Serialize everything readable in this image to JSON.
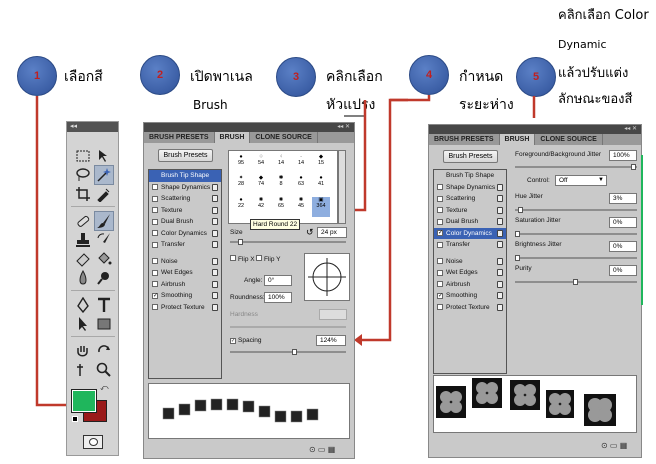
{
  "steps": [
    {
      "num": "1",
      "text": "เลือกสี"
    },
    {
      "num": "2",
      "text": "เปิดพาเนล",
      "text2": "Brush"
    },
    {
      "num": "3",
      "text": "คลิกเลือก",
      "text2": "หัวแปรง"
    },
    {
      "num": "4",
      "text": "กำหนด",
      "text2": "ระยะห่าง"
    },
    {
      "num": "5",
      "text": "คลิกเลือก Color",
      "text2": "Dynamic",
      "text3": "แล้วปรับแต่ง",
      "text4": "ลักษณะของสี"
    }
  ],
  "toolbar": {
    "collapse": "◂◂",
    "tools": [
      "marquee-icon",
      "move-icon",
      "lasso-icon",
      "magic-wand-icon",
      "crop-icon",
      "eyedropper-icon",
      "healing-icon",
      "brush-icon",
      "stamp-icon",
      "history-brush-icon",
      "eraser-icon",
      "bucket-icon",
      "blur-icon",
      "dodge-icon",
      "pen-icon",
      "type-icon",
      "path-select-icon",
      "shape-icon",
      "hand-icon",
      "rotate-icon",
      "zoom-icon",
      "zoom2-icon"
    ],
    "foreground_color": "#1fb65c",
    "background_color": "#9a1a1a"
  },
  "brush_panel": {
    "tabs": [
      "BRUSH PRESETS",
      "BRUSH",
      "CLONE SOURCE"
    ],
    "active_tab": "BRUSH",
    "presets_button": "Brush Presets",
    "options": [
      {
        "label": "Brush Tip Shape",
        "checked": false,
        "highlight": true
      },
      {
        "label": "Shape Dynamics",
        "checked": false
      },
      {
        "label": "Scattering",
        "checked": false
      },
      {
        "label": "Texture",
        "checked": false
      },
      {
        "label": "Dual Brush",
        "checked": false
      },
      {
        "label": "Color Dynamics",
        "checked": false
      },
      {
        "label": "Transfer",
        "checked": false
      },
      {
        "label": "Noise",
        "checked": false
      },
      {
        "label": "Wet Edges",
        "checked": false
      },
      {
        "label": "Airbrush",
        "checked": false
      },
      {
        "label": "Smoothing",
        "checked": true
      },
      {
        "label": "Protect Texture",
        "checked": false
      }
    ],
    "tip_sizes": [
      "95",
      "54",
      "14",
      "14",
      "15",
      "28",
      "74",
      "8",
      "63",
      "41",
      "22",
      "42",
      "65",
      "45",
      "364"
    ],
    "tooltip": "Hard Round 22",
    "size_label": "Size",
    "size_value": "24 px",
    "flip_x": "Flip X",
    "flip_y": "Flip Y",
    "angle_label": "Angle:",
    "angle_value": "0°",
    "roundness_label": "Roundness:",
    "roundness_value": "100%",
    "hardness_label": "Hardness",
    "spacing_label": "Spacing",
    "spacing_value": "124%"
  },
  "color_panel": {
    "tabs": [
      "BRUSH PRESETS",
      "BRUSH",
      "CLONE SOURCE"
    ],
    "active_tab": "BRUSH",
    "presets_button": "Brush Presets",
    "options": [
      {
        "label": "Brush Tip Shape",
        "checked": false
      },
      {
        "label": "Shape Dynamics",
        "checked": false
      },
      {
        "label": "Scattering",
        "checked": false
      },
      {
        "label": "Texture",
        "checked": false
      },
      {
        "label": "Dual Brush",
        "checked": false
      },
      {
        "label": "Color Dynamics",
        "checked": true,
        "highlight": true
      },
      {
        "label": "Transfer",
        "checked": false
      },
      {
        "label": "Noise",
        "checked": false
      },
      {
        "label": "Wet Edges",
        "checked": false
      },
      {
        "label": "Airbrush",
        "checked": false
      },
      {
        "label": "Smoothing",
        "checked": true
      },
      {
        "label": "Protect Texture",
        "checked": false
      }
    ],
    "fg_bg_label": "Foreground/Background Jitter",
    "fg_bg_value": "100%",
    "control_label": "Control:",
    "control_value": "Off",
    "hue_label": "Hue Jitter",
    "hue_value": "3%",
    "saturation_label": "Saturation Jitter",
    "saturation_value": "0%",
    "brightness_label": "Brightness Jitter",
    "brightness_value": "0%",
    "purity_label": "Purity",
    "purity_value": "0%"
  },
  "colors": {
    "arrow": "#c0392b",
    "step_fill": "#4a6fb5",
    "highlight": "#3a62b4"
  }
}
